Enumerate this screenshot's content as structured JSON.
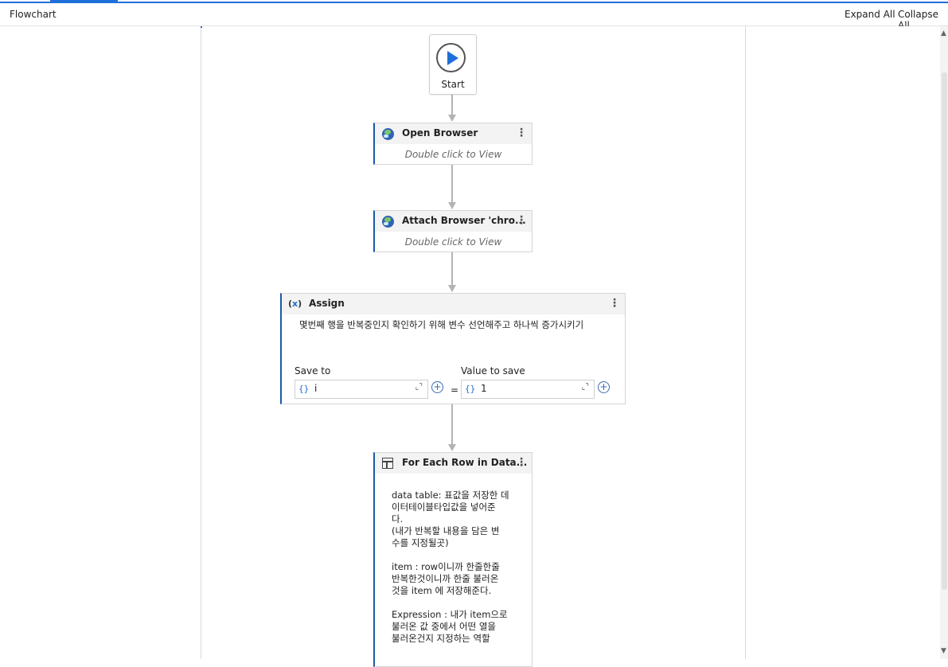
{
  "header": {
    "title": "Flowchart",
    "expand_all": "Expand All",
    "collapse_all": "Collapse All"
  },
  "start": {
    "label": "Start"
  },
  "activities": {
    "open_browser": {
      "title": "Open Browser",
      "hint": "Double click to View",
      "menu": "⋮"
    },
    "attach_browser": {
      "title": "Attach Browser 'chro...",
      "hint": "Double click to View",
      "menu": "⋮"
    },
    "assign": {
      "title": "Assign",
      "menu": "⋮",
      "description": "몇번째 행을 반복중인지 확인하기 위해 변수 선언해주고 하나씩 증가시키기",
      "save_to_label": "Save to",
      "save_to_value": "i",
      "value_to_save_label": "Value to save",
      "value_to_save_value": "1",
      "brace": "{}",
      "equals": "="
    },
    "for_each_row": {
      "title": "For Each Row in Data...",
      "menu": "⋮",
      "body": "data table: 표값을 저장한 데\n이터테이블타입값을 넣어준\n다.\n(내가 반복할 내용을 담은 변\n수를 지정될곳)\n\nitem : row이니까 한줄한줄\n반복한것이니까 한줄 불러온\n것을 item 에 저장해준다.\n\nExpression : 내가 item으로\n불러온 값 중에서 어떤 열을\n불러온건지 지정하는 역할"
    }
  },
  "icons": {
    "play": "play-icon",
    "globe": "globe-icon",
    "assign": "variable-icon",
    "for_each": "table-loop-icon"
  },
  "colors": {
    "accent": "#1e6fd9",
    "card_accent": "#1a5aa8"
  }
}
